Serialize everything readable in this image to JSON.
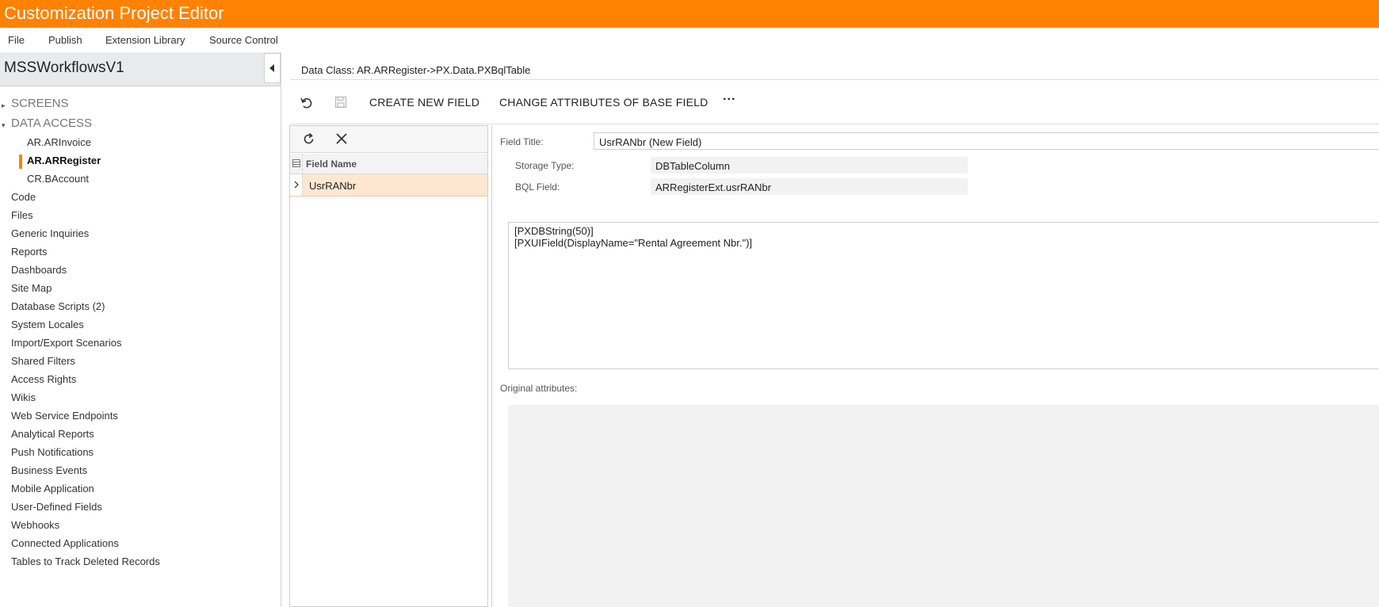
{
  "app": {
    "title": "Customization Project Editor"
  },
  "menu": {
    "items": [
      "File",
      "Publish",
      "Extension Library",
      "Source Control"
    ]
  },
  "project": {
    "name": "MSSWorkflowsV1"
  },
  "tree": {
    "screens": "SCREENS",
    "data_access": "DATA ACCESS",
    "data_access_items": [
      "AR.ARInvoice",
      "AR.ARRegister",
      "CR.BAccount"
    ],
    "selected_item": "AR.ARRegister",
    "items": [
      "Code",
      "Files",
      "Generic Inquiries",
      "Reports",
      "Dashboards",
      "Site Map",
      "Database Scripts (2)",
      "System Locales",
      "Import/Export Scenarios",
      "Shared Filters",
      "Access Rights",
      "Wikis",
      "Web Service Endpoints",
      "Analytical Reports",
      "Push Notifications",
      "Business Events",
      "Mobile Application",
      "User-Defined Fields",
      "Webhooks",
      "Connected Applications",
      "Tables to Track Deleted Records"
    ]
  },
  "main": {
    "data_class": "Data Class: AR.ARRegister->PX.Data.PXBqlTable",
    "toolbar": {
      "create_new_field": "CREATE NEW FIELD",
      "change_attributes": "CHANGE ATTRIBUTES OF BASE FIELD",
      "more": "···"
    },
    "grid": {
      "column": "Field Name",
      "rows": [
        "UsrRANbr"
      ]
    },
    "form": {
      "field_title_label": "Field Title:",
      "field_title_value": "UsrRANbr (New Field)",
      "storage_type_label": "Storage Type:",
      "storage_type_value": "DBTableColumn",
      "bql_field_label": "BQL Field:",
      "bql_field_value": "ARRegisterExt.usrRANbr",
      "code_lines": [
        "[PXDBString(50)]",
        "[PXUIField(DisplayName=\"Rental Agreement Nbr.\")]"
      ],
      "original_attributes_label": "Original attributes:"
    }
  },
  "colors": {
    "accent": "#ff8200",
    "selected_row": "#fde7d1"
  }
}
